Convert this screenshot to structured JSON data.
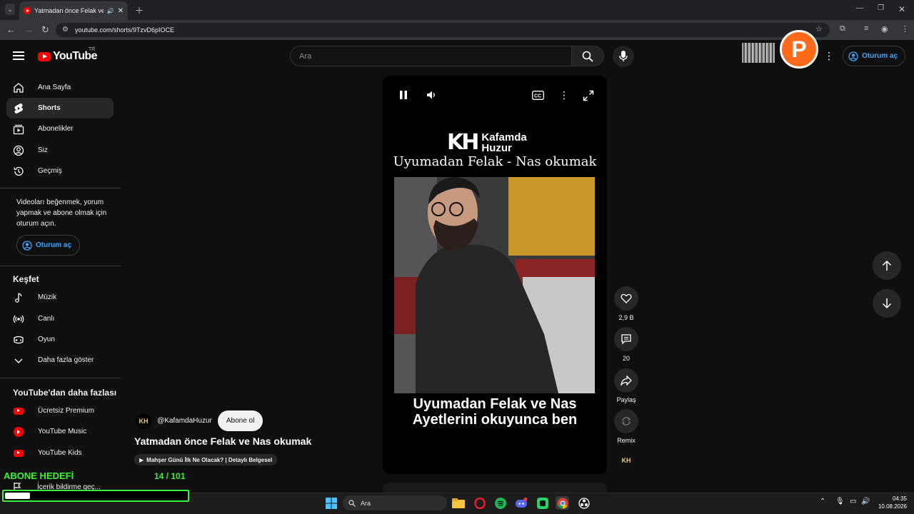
{
  "browser": {
    "tab_title": "Yatmadan önce Felak ve Nas okumak - YouTube",
    "url": "youtube.com/shorts/9TzvD6pIOCE"
  },
  "header": {
    "logo_text": "YouTube",
    "country_code": "TR",
    "search_placeholder": "Ara",
    "signin_label": "Oturum aç"
  },
  "sidebar": {
    "main_items": [
      {
        "label": "Ana Sayfa",
        "icon": "home-icon"
      },
      {
        "label": "Shorts",
        "icon": "shorts-icon",
        "active": true
      },
      {
        "label": "Abonelikler",
        "icon": "subscriptions-icon"
      },
      {
        "label": "Siz",
        "icon": "account-icon"
      },
      {
        "label": "Geçmiş",
        "icon": "history-icon"
      }
    ],
    "signin_prompt": "Videoları beğenmek, yorum yapmak ve abone olmak için oturum açın.",
    "signin_button": "Oturum aç",
    "explore_title": "Keşfet",
    "explore_items": [
      {
        "label": "Müzik",
        "icon": "music-icon"
      },
      {
        "label": "Canlı",
        "icon": "live-icon"
      },
      {
        "label": "Oyun",
        "icon": "gaming-icon"
      },
      {
        "label": "Daha fazla göster",
        "icon": "chevron-down-icon"
      }
    ],
    "more_title": "YouTube'dan daha fazlası",
    "more_items": [
      {
        "label": "Ücretsiz Premium",
        "icon": "youtube-premium-icon"
      },
      {
        "label": "YouTube Music",
        "icon": "youtube-music-icon"
      },
      {
        "label": "YouTube Kids",
        "icon": "youtube-kids-icon"
      }
    ],
    "report_label": "İçerik bildirme geç..."
  },
  "video": {
    "brand_mark": "KH",
    "brand_name_line1": "Kafamda",
    "brand_name_line2": "Huzur",
    "subtitle": "Uyumadan Felak - Nas okumak",
    "caption_line1": "Uyumadan Felak ve Nas",
    "caption_line2": "Ayetlerini okuyunca ben",
    "channel_handle": "@KafamdaHuzur",
    "subscribe_label": "Abone ol",
    "title": "Yatmadan önce Felak ve Nas okumak",
    "related_link": "Mahşer Günü İlk Ne Olacak? | Detaylı Belgesel"
  },
  "actions": {
    "like_count": "2,9 B",
    "comment_count": "20",
    "share_label": "Paylaş",
    "remix_label": "Remix"
  },
  "overlay": {
    "goal_label": "ABONE HEDEFİ",
    "goal_count": "14 / 101",
    "goal_progress": 0.139
  },
  "taskbar": {
    "search_label": "Ara",
    "time": "04:35",
    "date": "10.08.2026"
  }
}
